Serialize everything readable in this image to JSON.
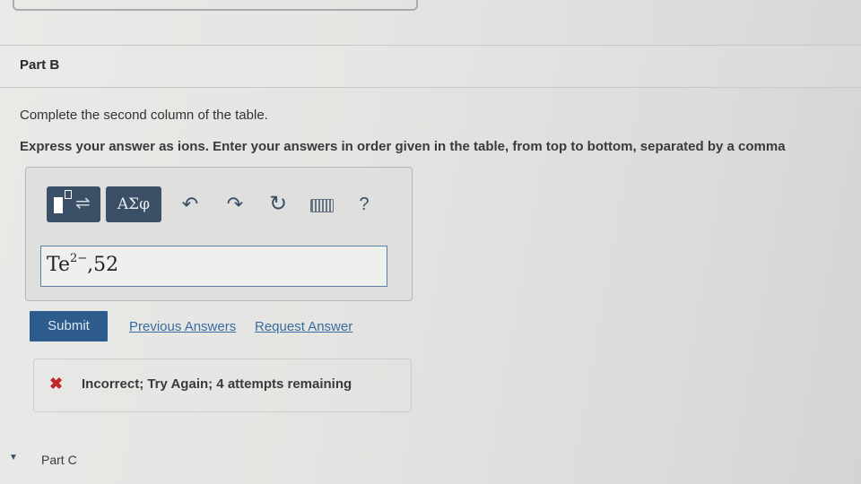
{
  "part_b": {
    "title": "Part B",
    "instruction_1": "Complete the second column of the table.",
    "instruction_2": "Express your answer as ions. Enter your answers in order given in the table, from top to bottom, separated by a comma"
  },
  "toolbar": {
    "symbols_label": "ΑΣφ",
    "help_label": "?"
  },
  "answer": {
    "species": "Te",
    "charge": "2−",
    "rest": ",52"
  },
  "actions": {
    "submit_label": "Submit",
    "previous_answers_label": "Previous Answers",
    "request_answer_label": "Request Answer"
  },
  "feedback": {
    "text": "Incorrect; Try Again; 4 attempts remaining",
    "status_color": "#c0282d"
  },
  "part_c": {
    "title": "Part C"
  },
  "colors": {
    "toolbar_button": "#3b4f66",
    "submit_button": "#2d5c8c",
    "link": "#3b6aa0"
  }
}
